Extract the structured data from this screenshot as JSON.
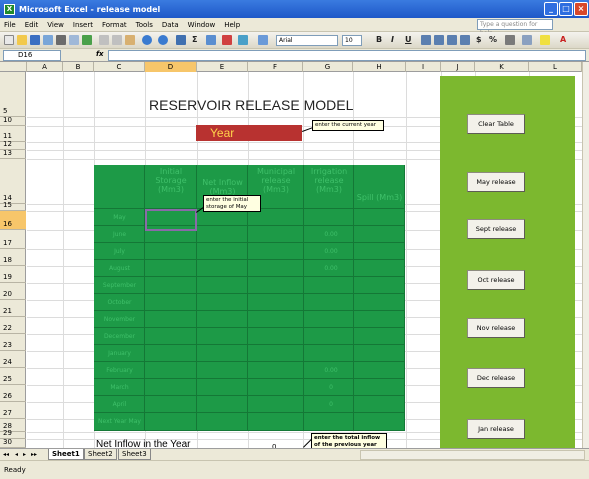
{
  "window": {
    "title": "Microsoft Excel - release model"
  },
  "menu": [
    "File",
    "Edit",
    "View",
    "Insert",
    "Format",
    "Tools",
    "Data",
    "Window",
    "Help"
  ],
  "help_placeholder": "Type a question for help",
  "toolbar": {
    "font": "Arial",
    "size": "10",
    "bold": "B",
    "italic": "I",
    "underline": "U"
  },
  "formula_bar": {
    "cell_ref": "D16",
    "fx": "fx",
    "value": ""
  },
  "columns": [
    "A",
    "B",
    "C",
    "D",
    "E",
    "F",
    "G",
    "H",
    "I",
    "J",
    "K",
    "L"
  ],
  "rows": [
    "5",
    "10",
    "11",
    "12",
    "13",
    "14",
    "15",
    "16",
    "17",
    "18",
    "19",
    "20",
    "21",
    "22",
    "23",
    "24",
    "25",
    "26",
    "27",
    "28",
    "29",
    "30"
  ],
  "sheet": {
    "title": "RESERVOIR RELEASE MODEL",
    "year_label": "Year",
    "notes": {
      "year": "enter the current year",
      "storage": "enter the initial storage of May",
      "inflow": "enter the total inflow of the previous year"
    },
    "table": {
      "headers": [
        "Initial Storage (Mm3)",
        "Net Inflow (Mm3)",
        "Municipal release (Mm3)",
        "Irrigation release (Mm3)",
        "Spill (Mm3)"
      ],
      "months": [
        "May",
        "June",
        "July",
        "August",
        "September",
        "October",
        "November",
        "December",
        "January",
        "February",
        "March",
        "April",
        "Next Year May"
      ],
      "irrigation": [
        "",
        "0.00",
        "0.00",
        "0.00",
        "",
        "",
        "",
        "",
        "",
        "0.00",
        "0",
        "0",
        ""
      ]
    },
    "net_inflow_label": "Net Inflow in the Year",
    "net_inflow_value": "0",
    "buttons": [
      "Clear Table",
      "May release",
      "Sept release",
      "Oct release",
      "Nov release",
      "Dec release",
      "Jan release"
    ]
  },
  "sheet_tabs": [
    "Sheet1",
    "Sheet2",
    "Sheet3"
  ],
  "status": "Ready"
}
